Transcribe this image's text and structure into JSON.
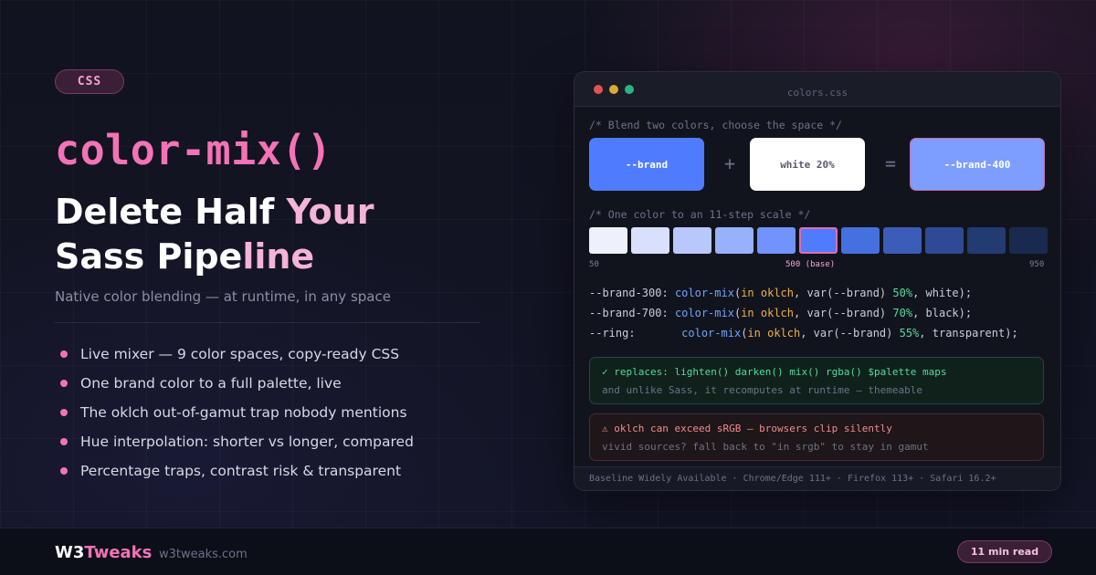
{
  "tag": "CSS",
  "function_title": "color-mix()",
  "headline": {
    "line1_prefix": "Delete Half ",
    "line1_accent": "Your",
    "line2_prefix": "Sass Pipe",
    "line2_accent": "line"
  },
  "subtitle": "Native color blending — at runtime, in any space",
  "features": [
    "Live mixer — 9 color spaces, copy-ready CSS",
    "One brand color to a full palette, live",
    "The oklch out-of-gamut trap nobody mentions",
    "Hue interpolation: shorter vs longer, compared",
    "Percentage traps, contrast risk & transparent"
  ],
  "window": {
    "filename": "colors.css",
    "comment_blend": "/* Blend two colors, choose the space */",
    "swatch_a": "--brand",
    "swatch_b": "white 20%",
    "swatch_result": "--brand-400",
    "op_plus": "+",
    "op_equals": "=",
    "comment_scale": "/* One color to an 11-step scale */",
    "scale_colors": [
      "#eef1fd",
      "#d8e0fb",
      "#b8c8fb",
      "#97b1fc",
      "#7093fd",
      "#4f7cff",
      "#4570df",
      "#3b5db9",
      "#2e4a94",
      "#233b73",
      "#1a2a4f"
    ],
    "scale_base_index": 5,
    "scale_labels": {
      "start": "50",
      "base": "500 (base)",
      "end": "950"
    },
    "code": [
      {
        "prop": "--brand-300:",
        "pad": " ",
        "fn": "color-mix",
        "in": "in oklch",
        "var": "var(--brand)",
        "pct": "50%",
        "tail": "white);"
      },
      {
        "prop": "--brand-700:",
        "pad": " ",
        "fn": "color-mix",
        "in": "in oklch",
        "var": "var(--brand)",
        "pct": "70%",
        "tail": "black);"
      },
      {
        "prop": "--ring:",
        "pad": "       ",
        "fn": "color-mix",
        "in": "in oklch",
        "var": "var(--brand)",
        "pct": "55%",
        "tail": "transparent);"
      }
    ],
    "callout_ok": {
      "line1": "✓ replaces: lighten() darken() mix() rgba() $palette maps",
      "line2": "and unlike Sass, it recomputes at runtime — themeable"
    },
    "callout_warn": {
      "line1": "⚠ oklch can exceed sRGB — browsers clip silently",
      "line2": "vivid sources? fall back to \"in srgb\" to stay in gamut"
    },
    "status": "Baseline Widely Available · Chrome/Edge 111+ · Firefox 113+ · Safari 16.2+"
  },
  "footer": {
    "brand_a": "W3",
    "brand_b": "Tweaks",
    "domain": "w3tweaks.com",
    "read_time": "11 min read"
  },
  "colors": {
    "accent_pink": "#f472b6",
    "brand_blue": "#4f7cff",
    "ok_green": "#4fdc9c",
    "warn_red": "#f48b8b"
  }
}
